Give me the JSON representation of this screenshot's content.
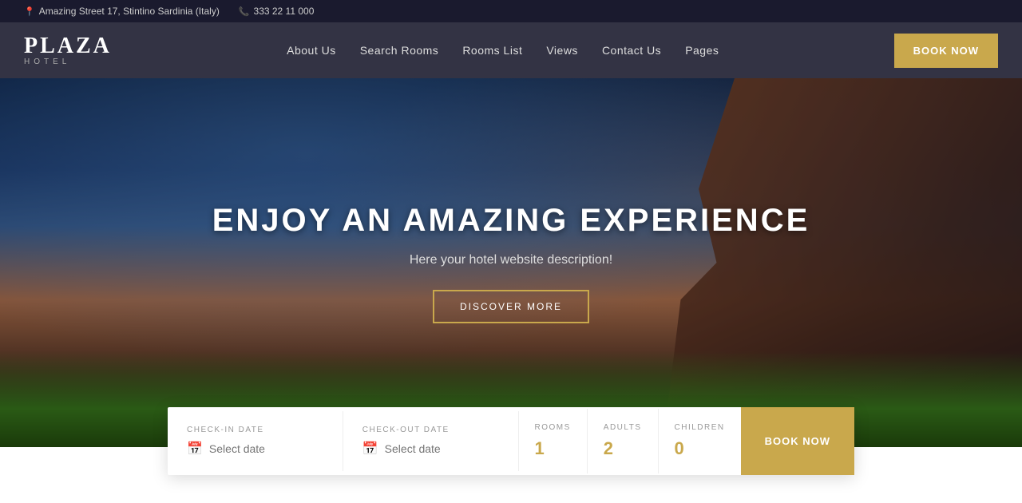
{
  "topbar": {
    "address": "Amazing Street 17, Stintino Sardinia (Italy)",
    "phone": "333 22 11 000"
  },
  "header": {
    "logo_title": "PLAZA",
    "logo_sub": "HOTEL",
    "nav": [
      {
        "label": "About Us",
        "id": "about-us"
      },
      {
        "label": "Search Rooms",
        "id": "search-rooms"
      },
      {
        "label": "Rooms List",
        "id": "rooms-list"
      },
      {
        "label": "Views",
        "id": "views"
      },
      {
        "label": "Contact Us",
        "id": "contact-us"
      },
      {
        "label": "Pages",
        "id": "pages"
      }
    ],
    "book_now": "BOOK NOW"
  },
  "hero": {
    "title": "ENJOY AN AMAZING EXPERIENCE",
    "description": "Here your hotel website description!",
    "discover_btn": "DISCOVER MORE"
  },
  "booking": {
    "checkin_label": "CHECK-IN DATE",
    "checkin_placeholder": "Select date",
    "checkout_label": "CHECK-OUT DATE",
    "checkout_placeholder": "Select date",
    "rooms_label": "ROOMS",
    "rooms_value": "1",
    "adults_label": "ADULTS",
    "adults_value": "2",
    "children_label": "CHILDREN",
    "children_value": "0",
    "book_btn": "BOOK NOW"
  },
  "colors": {
    "gold": "#c9a84c",
    "dark_nav": "rgba(15,15,35,0.85)",
    "topbar_bg": "#1a1a2e"
  }
}
